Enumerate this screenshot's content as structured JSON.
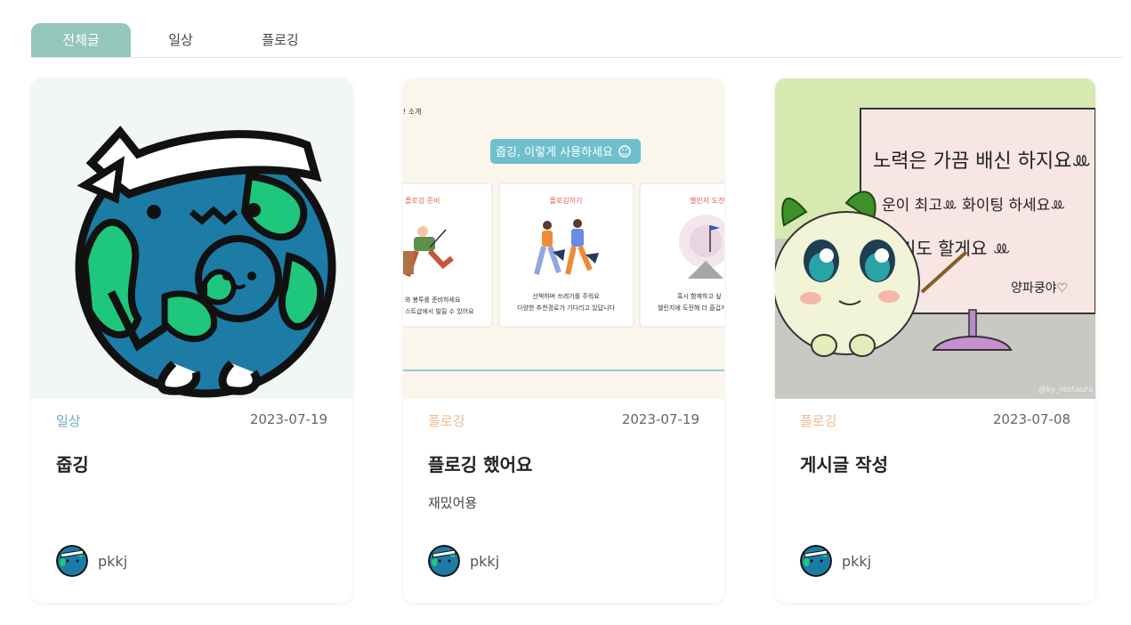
{
  "tabs": [
    {
      "label": "전체글",
      "active": true
    },
    {
      "label": "일상",
      "active": false
    },
    {
      "label": "플로깅",
      "active": false
    }
  ],
  "colors": {
    "accent": "#94c6bb",
    "category_daily": "#6aa9c9",
    "category_plogging": "#f0b98b"
  },
  "posts": [
    {
      "category": "일상",
      "category_color": "#6aa9c9",
      "date": "2023-07-19",
      "title": "줍깅",
      "content": "",
      "author": "pkkj",
      "image_icon": "earth-character-icon"
    },
    {
      "category": "플로깅",
      "category_color": "#f0b98b",
      "date": "2023-07-19",
      "title": "플로깅 했어요",
      "content": "재밌어용",
      "author": "pkkj",
      "image_icon": "app-guide-screenshot",
      "image_text": {
        "corner": "! 소개",
        "banner": "줍깅, 이렇게 사용하세요",
        "col1_title": "플로깅 준비",
        "col1_line1": "와 봉투를 준비하세요",
        "col1_line2": "스트샵에서 빌릴 수 있어요",
        "col2_title": "플로깅하기",
        "col2_line1": "산책하며 쓰레기를 주워요",
        "col2_line2": "다양한 추천경로가 기다리고 있답니다",
        "col3_title": "챌린지 도전",
        "col3_line1": "혹시 함께하고 싶",
        "col3_line2": "챌린지에 도전해 더 즐겁게"
      }
    },
    {
      "category": "플로깅",
      "category_color": "#f0b98b",
      "date": "2023-07-08",
      "title": "게시글 작성",
      "content": "",
      "author": "pkkj",
      "image_icon": "sprout-character-sign-icon",
      "image_text": {
        "line1": "노력은 가끔 배신 하지요ꔛ",
        "line2": "운이 최고ꔛ 화이팅 하세요ꔛ",
        "line3": "기도 할게요 ꔛ",
        "line4": "양파쿵야♡",
        "watermark": "@ky_restaura"
      }
    }
  ]
}
